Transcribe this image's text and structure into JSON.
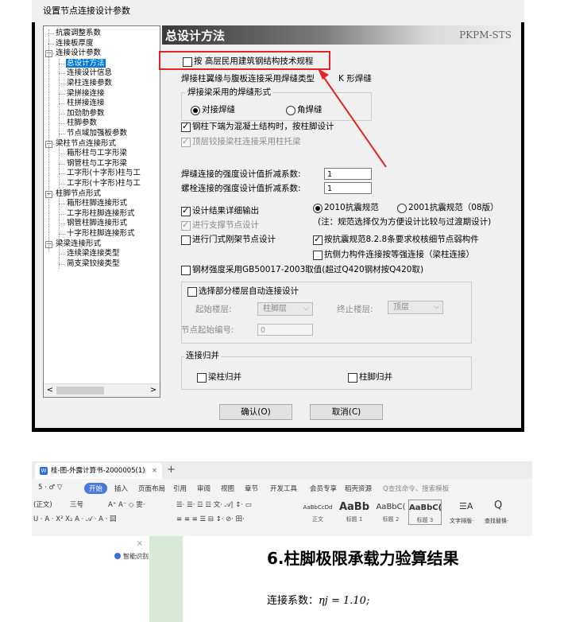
{
  "dialog": {
    "title": "设置节点连接设计参数",
    "tree": {
      "items": [
        {
          "label": "抗震调整系数",
          "level": 1
        },
        {
          "label": "连接板厚度",
          "level": 1
        },
        {
          "label": "连接设计参数",
          "level": 1,
          "expander": "−"
        },
        {
          "label": "总设计方法",
          "level": 2,
          "selected": true
        },
        {
          "label": "连接设计信息",
          "level": 2
        },
        {
          "label": "梁柱连接参数",
          "level": 2
        },
        {
          "label": "梁拼接连接",
          "level": 2
        },
        {
          "label": "柱拼接连接",
          "level": 2
        },
        {
          "label": "加劲肋参数",
          "level": 2
        },
        {
          "label": "柱脚参数",
          "level": 2
        },
        {
          "label": "节点域加强板参数",
          "level": 2
        },
        {
          "label": "梁柱节点连接形式",
          "level": 1,
          "expander": "−"
        },
        {
          "label": "箱形柱与工字形梁",
          "level": 2
        },
        {
          "label": "钢管柱与工字形梁",
          "level": 2
        },
        {
          "label": "工字形(十字形)柱与工",
          "level": 2
        },
        {
          "label": "工字形(十字形)柱与工",
          "level": 2
        },
        {
          "label": "柱脚节点形式",
          "level": 1,
          "expander": "−"
        },
        {
          "label": "箱形柱脚连接形式",
          "level": 2
        },
        {
          "label": "工字形柱脚连接形式",
          "level": 2
        },
        {
          "label": "钢管柱脚连接形式",
          "level": 2
        },
        {
          "label": "十字形柱脚连接形式",
          "level": 2
        },
        {
          "label": "梁梁连接形式",
          "level": 1,
          "expander": "−"
        },
        {
          "label": "连续梁连接类型",
          "level": 2
        },
        {
          "label": "简支梁铰接类型",
          "level": 2
        }
      ],
      "scroll_left": "<",
      "scroll_right": ">"
    },
    "panel": {
      "title": "总设计方法",
      "brand": "PKPM-STS",
      "high_rise_spec": {
        "label": "按 高层民用建筑钢结构技术规程",
        "checked": false
      },
      "weld_type_label": "焊接柱翼缘与腹板连接采用焊缝类型",
      "weld_type_value": "K 形焊缝",
      "weld_form_group": "焊接梁采用的焊缝形式",
      "weld_form_options": [
        {
          "label": "对接焊缝",
          "selected": true
        },
        {
          "label": "角焊缝",
          "selected": false
        }
      ],
      "column_base_design": {
        "label": "钢柱下端为混凝土结构时，按柱脚设计",
        "checked": true
      },
      "top_hinge_beam": {
        "label": "顶层铰接梁柱连接采用柱托梁",
        "checked": true,
        "disabled": true
      },
      "weld_strength_label": "焊缝连接的强度设计值折减系数:",
      "weld_strength_value": "1",
      "bolt_strength_label": "螺栓连接的强度设计值折减系数:",
      "bolt_strength_value": "1",
      "detailed_output": {
        "label": "设计结果详细输出",
        "checked": true
      },
      "code_options": [
        {
          "label": "2010抗震规范",
          "selected": true
        },
        {
          "label": "2001抗震规范（08版）",
          "selected": false
        }
      ],
      "code_note": "(注：规范选择仅为方便设计比较与过渡期设计)",
      "support_node_design": {
        "label": "进行支撑节点设计",
        "checked": true,
        "disabled": true
      },
      "portal_frame_design": {
        "label": "进行门式刚架节点设计",
        "checked": false
      },
      "seismic_weak_member": {
        "label": "按抗震规范8.2.8条要求校核细节点弱构件",
        "checked": true
      },
      "lateral_force_member": {
        "label": "抗侧力构件连接按等强连接（梁柱连接）",
        "checked": false
      },
      "steel_strength": {
        "label": "钢材强度采用GB50017-2003取值(超过Q420钢材按Q420取)",
        "checked": false
      },
      "partial_floor": {
        "label": "选择部分楼层自动连接设计",
        "checked": false
      },
      "start_floor_label": "起始楼层:",
      "start_floor_value": "柱脚层",
      "end_floor_label": "终止楼层:",
      "end_floor_value": "顶层",
      "node_start_label": "节点起始编号:",
      "node_start_value": "0",
      "merge_group": "连接归并",
      "beam_column_merge": {
        "label": "梁柱归并",
        "checked": false
      },
      "column_base_merge": {
        "label": "柱脚归并",
        "checked": false
      }
    },
    "ok_button": "确认(O)",
    "cancel_button": "取消(C)",
    "colors": {
      "highlight": "#e42424",
      "selection": "#0078d7"
    }
  },
  "word": {
    "tab_title": "桂-图-外露计算书-2000005(1)",
    "tab_icon": "W",
    "tab_close": "×",
    "tab_dot": "○",
    "new_tab": "+",
    "menu": {
      "quick": "5 · ♂ ▽",
      "active": "开始",
      "items": [
        "插入",
        "页面布局",
        "引用",
        "审阅",
        "视图",
        "章节",
        "开发工具",
        "会员专享",
        "稻壳资源"
      ],
      "search": "Q查找命令、搜索模板"
    },
    "ribbon": {
      "font_name": "(正文)",
      "font_size": "三号",
      "row1_tools": "A⁺ A⁻ ◇ 雯·",
      "row2_tools": "U · A · X² X₂ A · 𝒜 · A · 囧",
      "para_tools1": "☰· ☰· ☲ ☲ 文· 𝒜| ↕· ▭",
      "para_tools2": "≡ ≡ ≡ ☰ ⊟ ↕· ⊘· 田·",
      "styles": [
        {
          "sample": "AaBbCcDd",
          "caption": "正文"
        },
        {
          "sample": "AaBb",
          "caption": "标题 1"
        },
        {
          "sample": "AaBbC(",
          "caption": "标题 2"
        },
        {
          "sample": "AaBbC(",
          "caption": "标题 3"
        }
      ],
      "text_layout": "文字排版·",
      "find_replace": "查找替换·",
      "text_layout_icon": "☰A",
      "find_icon": "Q"
    },
    "sidebar": {
      "close": "×",
      "ai_label": "智能识别目录"
    },
    "document": {
      "heading": "6.柱脚极限承载力验算结果",
      "coefficient_label": "连接系数：",
      "coefficient_math": "ηj = 1.10;"
    }
  }
}
